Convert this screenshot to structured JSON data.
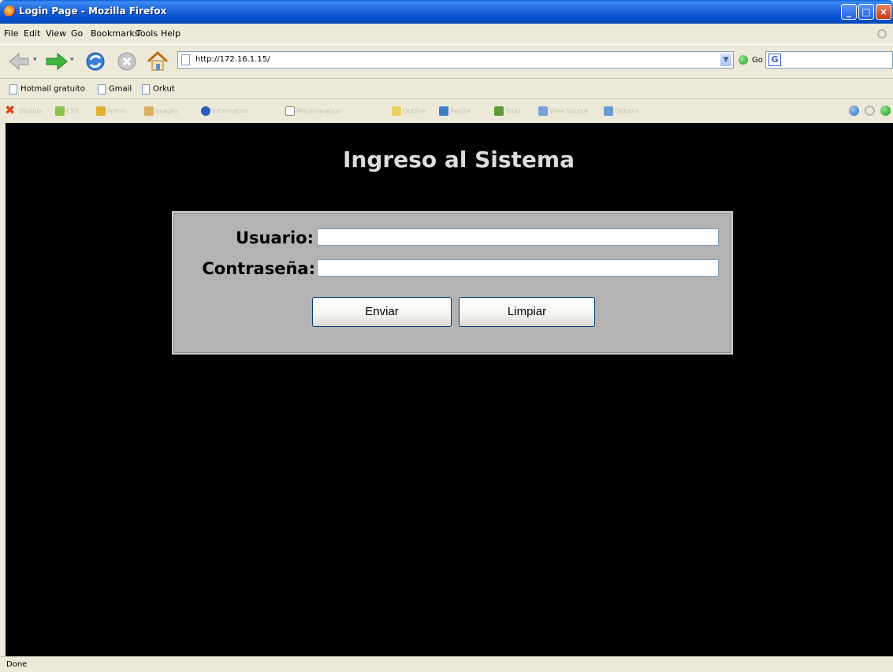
{
  "window": {
    "title": "Login Page - Mozilla Firefox"
  },
  "menu": [
    "File",
    "Edit",
    "View",
    "Go",
    "Bookmarks",
    "Tools",
    "Help"
  ],
  "navigation": {
    "url": "http://172.16.1.15/",
    "go_label": "Go",
    "search_value": ""
  },
  "bookmarks": [
    "Hotmail gratuito",
    "Gmail",
    "Orkut"
  ],
  "devtoolbar": [
    "Disable",
    "CSS",
    "Forms",
    "Images",
    "Information",
    "Miscellaneous",
    "Outline",
    "Resize",
    "Tools",
    "View Source",
    "Options"
  ],
  "page": {
    "heading": "Ingreso al Sistema",
    "username_label": "Usuario:",
    "username_value": "",
    "password_label": "Contraseña:",
    "password_value": "",
    "submit_label": "Enviar",
    "clear_label": "Limpiar"
  },
  "status": {
    "text": "Done"
  },
  "colors": {
    "titlebar": "#0a5fd8",
    "content_background": "#000000",
    "form_background": "#b3b3b3",
    "heading": "#dcdcdc"
  }
}
